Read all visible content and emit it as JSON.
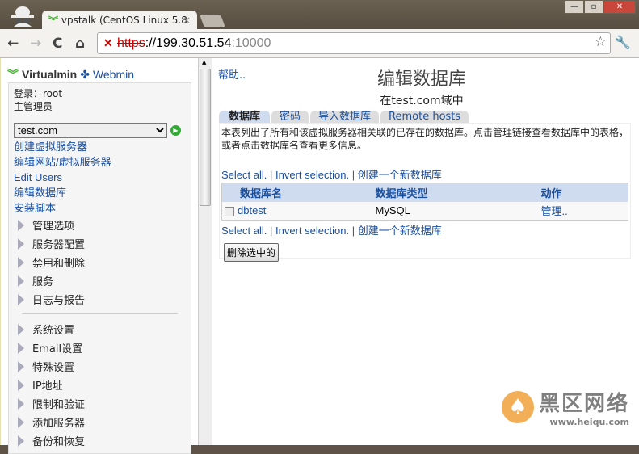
{
  "browser": {
    "tab_title": "vpstalk (CentOS Linux 5.8",
    "url_protocol": "https",
    "url_host": "://199.30.51.54",
    "url_port": ":10000"
  },
  "sidebar": {
    "virtualmin": "Virtualmin",
    "webmin": "Webmin",
    "login": "登录：root",
    "role": "主管理员",
    "domain": "test.com",
    "links": [
      "创建虚拟服务器",
      "编辑网站/虚拟服务器",
      "Edit Users",
      "编辑数据库",
      "安装脚本"
    ],
    "categories1": [
      "管理选项",
      "服务器配置",
      "禁用和删除",
      "服务",
      "日志与报告"
    ],
    "categories2": [
      "系统设置",
      "Email设置",
      "特殊设置",
      "IP地址",
      "限制和验证",
      "添加服务器",
      "备份和恢复"
    ]
  },
  "main": {
    "help": "帮助..",
    "title": "编辑数据库",
    "subtitle": "在test.com域中",
    "tabs": [
      "数据库",
      "密码",
      "导入数据库",
      "Remote hosts"
    ],
    "description": "本表列出了所有和该虚拟服务器相关联的已存在的数据库。点击管理链接查看数据库中的表格，或者点击数据库名查看更多信息。",
    "select_all": "Select all.",
    "invert": "Invert selection.",
    "create": "创建一个新数据库",
    "columns": [
      "数据库名",
      "数据库类型",
      "动作"
    ],
    "rows": [
      {
        "name": "dbtest",
        "type": "MySQL",
        "action": "管理.."
      }
    ],
    "delete_button": "删除选中的"
  },
  "watermark": {
    "name": "黑区网络",
    "url": "www.heiqu.com"
  }
}
